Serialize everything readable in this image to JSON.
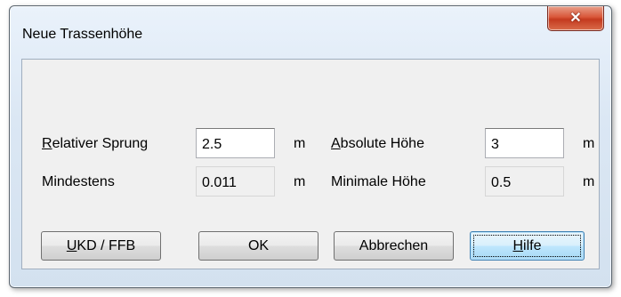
{
  "window": {
    "title": "Neue Trassenhöhe"
  },
  "form": {
    "relativer_sprung": {
      "label_accel": "R",
      "label_rest": "elativer Sprung",
      "value": "2.5",
      "unit": "m"
    },
    "mindestens": {
      "label": "Mindestens",
      "value": "0.011",
      "unit": "m"
    },
    "absolute_hoehe": {
      "label_accel": "A",
      "label_rest": "bsolute Höhe",
      "value": "3",
      "unit": "m"
    },
    "minimale_hoehe": {
      "label": "Minimale Höhe",
      "value": "0.5",
      "unit": "m"
    }
  },
  "buttons": {
    "ukd_accel": "U",
    "ukd_rest": "KD / FFB",
    "ok": "OK",
    "abbrechen": "Abbrechen",
    "hilfe_accel": "H",
    "hilfe_rest": "ilfe"
  },
  "icons": {
    "close": "close-icon"
  }
}
